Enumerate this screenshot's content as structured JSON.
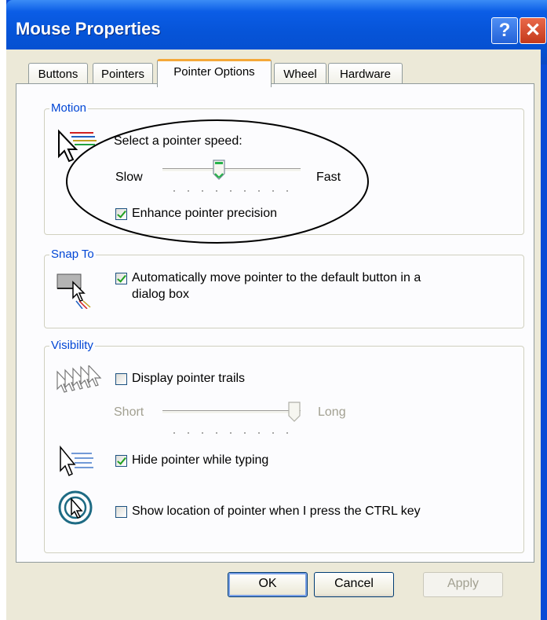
{
  "window": {
    "title": "Mouse Properties",
    "help_glyph": "?",
    "close_glyph": "✕"
  },
  "tabs": [
    "Buttons",
    "Pointers",
    "Pointer Options",
    "Wheel",
    "Hardware"
  ],
  "active_tab": "Pointer Options",
  "motion": {
    "label": "Motion",
    "speed_prompt": "Select a pointer speed:",
    "slow_label": "Slow",
    "fast_label": "Fast",
    "speed_level": 0.4,
    "enhance_label": "Enhance pointer precision",
    "enhance_checked": true
  },
  "snap": {
    "label": "Snap To",
    "line1": "Automatically move pointer to the default button in a",
    "line2": "dialog box",
    "checked": true
  },
  "visibility": {
    "label": "Visibility",
    "trails_label": "Display pointer trails",
    "trails_checked": false,
    "short_label": "Short",
    "long_label": "Long",
    "trail_level": 1.0,
    "hide_label": "Hide pointer while typing",
    "hide_checked": true,
    "ctrl_label": "Show location of pointer when I press the CTRL key",
    "ctrl_checked": false
  },
  "buttons": {
    "ok": "OK",
    "cancel": "Cancel",
    "apply": "Apply"
  },
  "colors": {
    "titlebar": "#0550d0",
    "accent": "#0046d5",
    "tab_highlight": "#f4a83a"
  },
  "icons": [
    "mouse-speed-icon",
    "snap-to-icon",
    "pointer-trails-icon",
    "hide-pointer-icon",
    "pointer-location-icon",
    "help-icon",
    "close-icon"
  ]
}
